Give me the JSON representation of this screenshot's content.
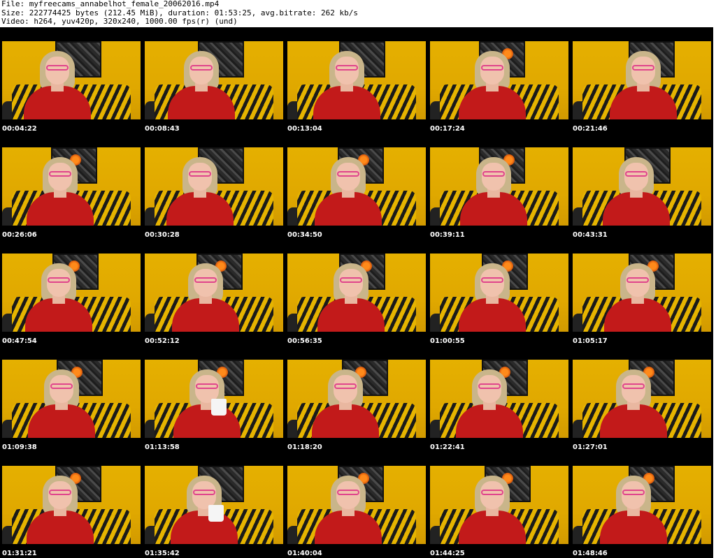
{
  "header": {
    "line1": "File: myfreecams_annabelhot_female_20062016.mp4",
    "line2": "Size: 222774425 bytes (212.45 MiB), duration: 01:53:25, avg.bitrate: 262 kb/s",
    "line3": "Video: h264, yuv420p, 320x240, 1000.00 fps(r) (und)"
  },
  "thumbnails": [
    {
      "time": "00:04:22"
    },
    {
      "time": "00:08:43"
    },
    {
      "time": "00:13:04"
    },
    {
      "time": "00:17:24"
    },
    {
      "time": "00:21:46"
    },
    {
      "time": "00:26:06"
    },
    {
      "time": "00:30:28"
    },
    {
      "time": "00:34:50"
    },
    {
      "time": "00:39:11"
    },
    {
      "time": "00:43:31"
    },
    {
      "time": "00:47:54"
    },
    {
      "time": "00:52:12"
    },
    {
      "time": "00:56:35"
    },
    {
      "time": "01:00:55"
    },
    {
      "time": "01:05:17"
    },
    {
      "time": "01:09:38"
    },
    {
      "time": "01:13:58"
    },
    {
      "time": "01:18:20"
    },
    {
      "time": "01:22:41"
    },
    {
      "time": "01:27:01"
    },
    {
      "time": "01:31:21"
    },
    {
      "time": "01:35:42"
    },
    {
      "time": "01:40:04"
    },
    {
      "time": "01:44:25"
    },
    {
      "time": "01:48:46"
    }
  ],
  "colors": {
    "background": "#ffffff",
    "frame": "#000000",
    "timestamp": "#ffffff",
    "wall": "#e5b000",
    "shirt": "#c21a1a"
  }
}
